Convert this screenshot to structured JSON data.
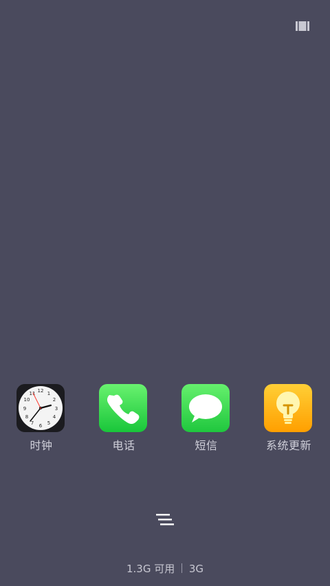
{
  "top_right": {
    "icon": "layout-icon"
  },
  "dock": {
    "apps": [
      {
        "label": "时钟",
        "icon": "clock-icon"
      },
      {
        "label": "电话",
        "icon": "phone-icon"
      },
      {
        "label": "短信",
        "icon": "message-icon"
      },
      {
        "label": "系统更新",
        "icon": "bulb-icon"
      }
    ]
  },
  "bottom": {
    "menu_icon": "menu-icon",
    "storage_available": "1.3G 可用",
    "network": "3G"
  }
}
